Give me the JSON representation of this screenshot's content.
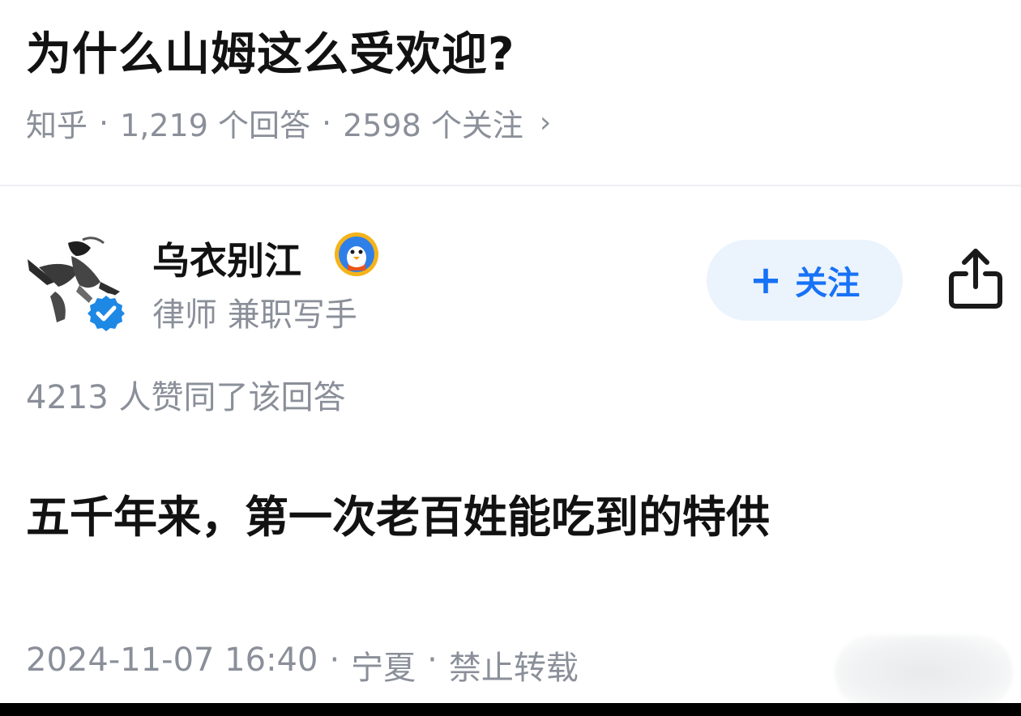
{
  "question": {
    "title": "为什么山姆这么受欢迎?",
    "source": "知乎",
    "answers": "1,219 个回答",
    "followers": "2598 个关注",
    "sep": "·",
    "chevron": "›"
  },
  "author": {
    "name": "乌衣别江",
    "description": "律师 兼职写手",
    "avatar_icon": "ink-painting-avatar",
    "verified_icon": "verified-badge-icon",
    "badge_icon": "penguin-badge-icon"
  },
  "follow_button": {
    "plus": "+",
    "label": "关注"
  },
  "answer": {
    "votes": "4213 人赞同了该回答",
    "body": "五千年来，第一次老百姓能吃到的特供",
    "date": "2024-11-07 16:40",
    "location": "宁夏",
    "copyright": "禁止转载",
    "sep": "·"
  },
  "colors": {
    "accent": "#1772f6",
    "follow_bg": "#ebf3fd",
    "meta_gray": "#8a8f99",
    "text": "#121212"
  }
}
